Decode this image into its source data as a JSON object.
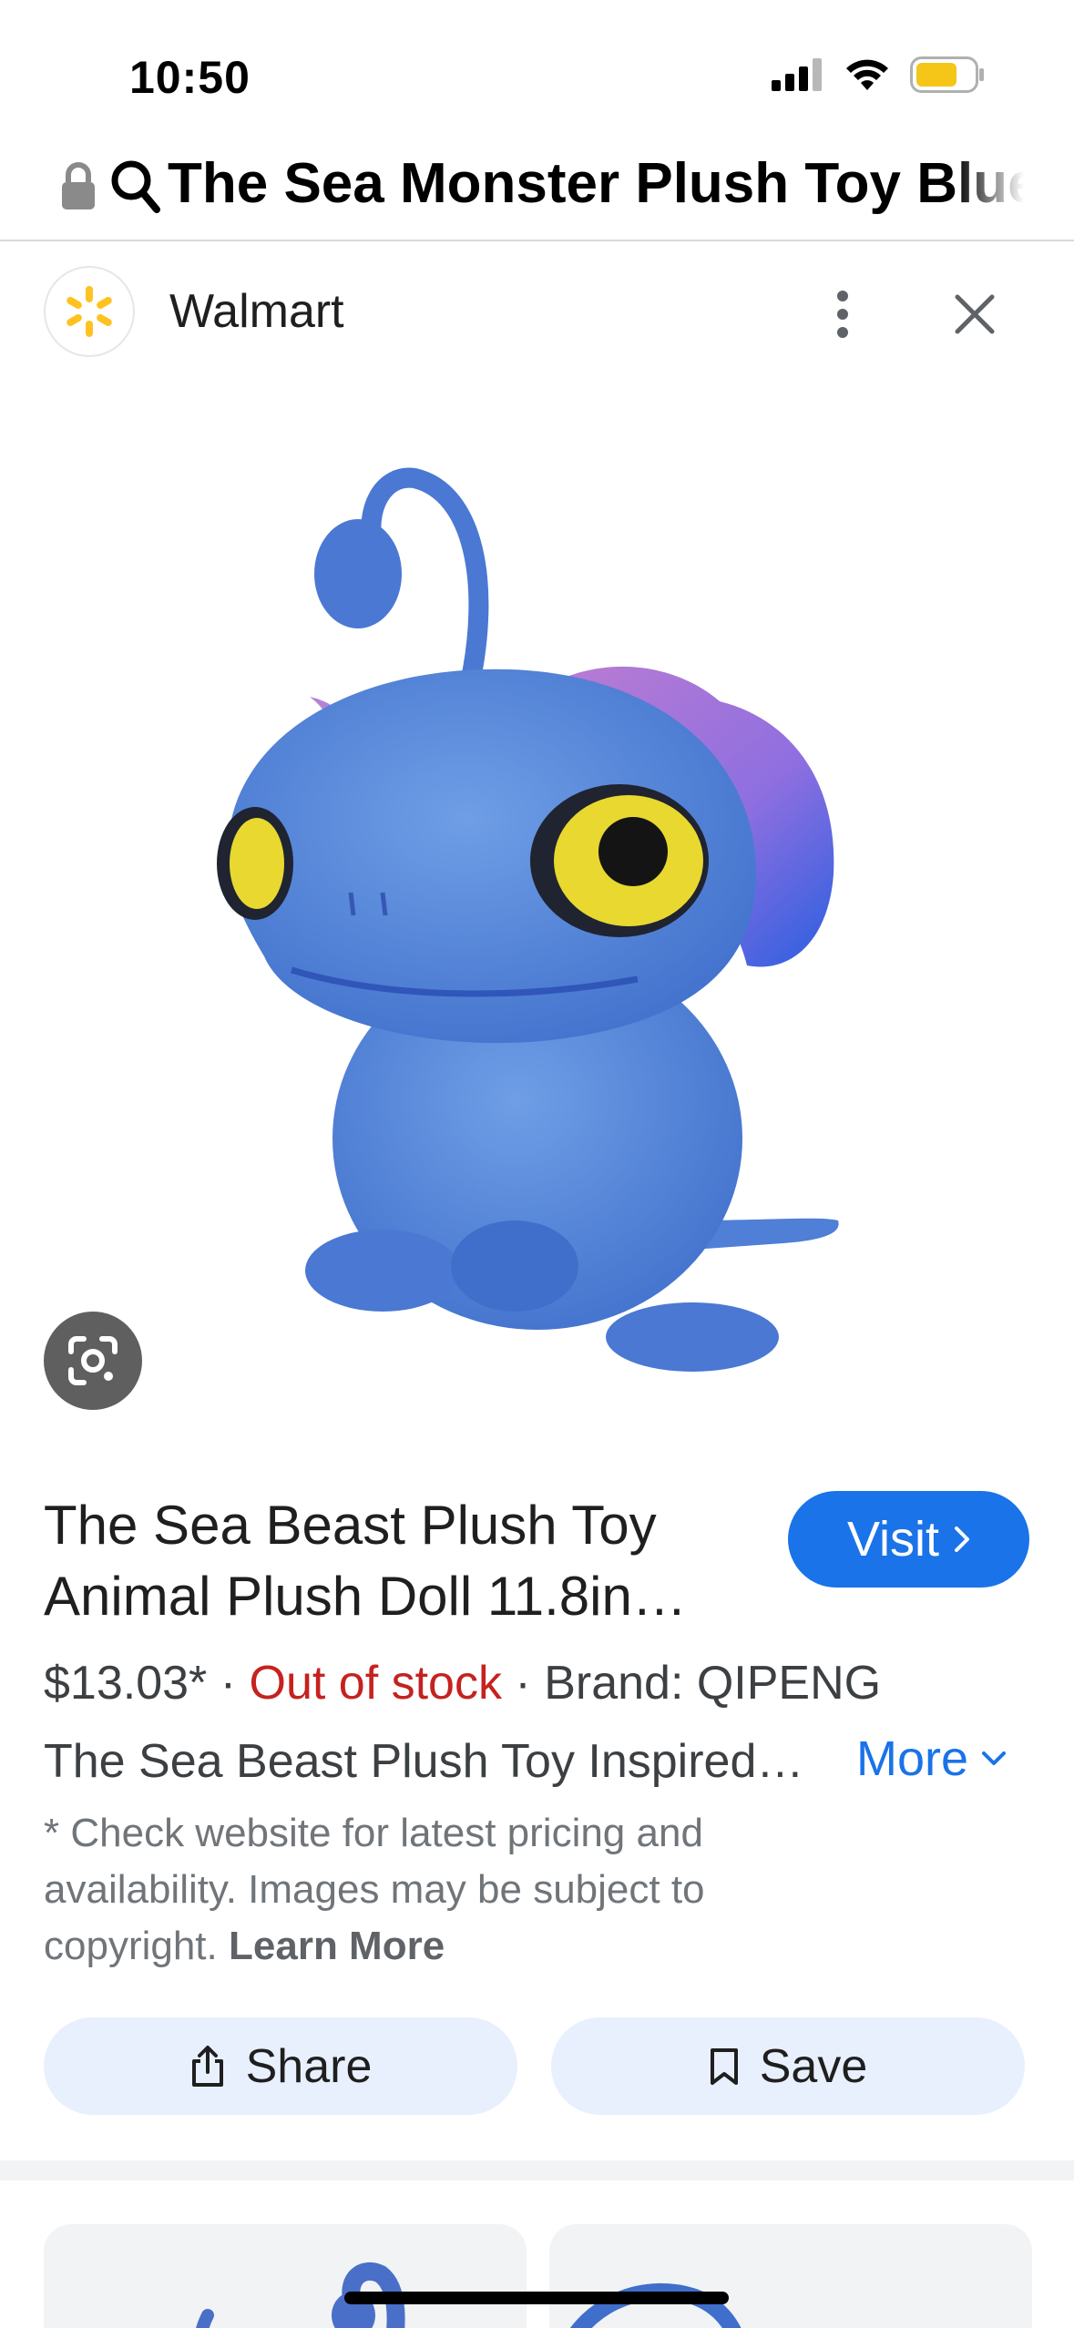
{
  "status_bar": {
    "time": "10:50",
    "icons": [
      "cellular-signal-icon",
      "wifi-icon",
      "battery-icon"
    ],
    "battery_color": "#f5c518"
  },
  "url_bar": {
    "text": "The Sea Monster Plush Toy Blue",
    "icons": [
      "lock-icon",
      "search-icon"
    ]
  },
  "source": {
    "name": "Walmart",
    "logo_icon": "walmart-spark-icon",
    "logo_color": "#ffc220"
  },
  "product": {
    "image_icon": "blue-sea-beast-plush-image",
    "title": "The Sea Beast Plush Toy Animal Plush Doll 11.8in…",
    "visit_label": "Visit",
    "price": "$13.03*",
    "separator": " · ",
    "stock": "Out of stock",
    "brand": "Brand: QIPENG",
    "description": "The Sea Beast Plush Toy Inspired…",
    "more_label": "More",
    "disclaimer": "* Check website for latest pricing and availability. Images may be subject to copyright.",
    "learn_more": "Learn More"
  },
  "actions": {
    "share_label": "Share",
    "save_label": "Save"
  },
  "colors": {
    "accent": "#1a73e8",
    "out_of_stock": "#c5221f",
    "button_bg": "#e8f0fe"
  }
}
